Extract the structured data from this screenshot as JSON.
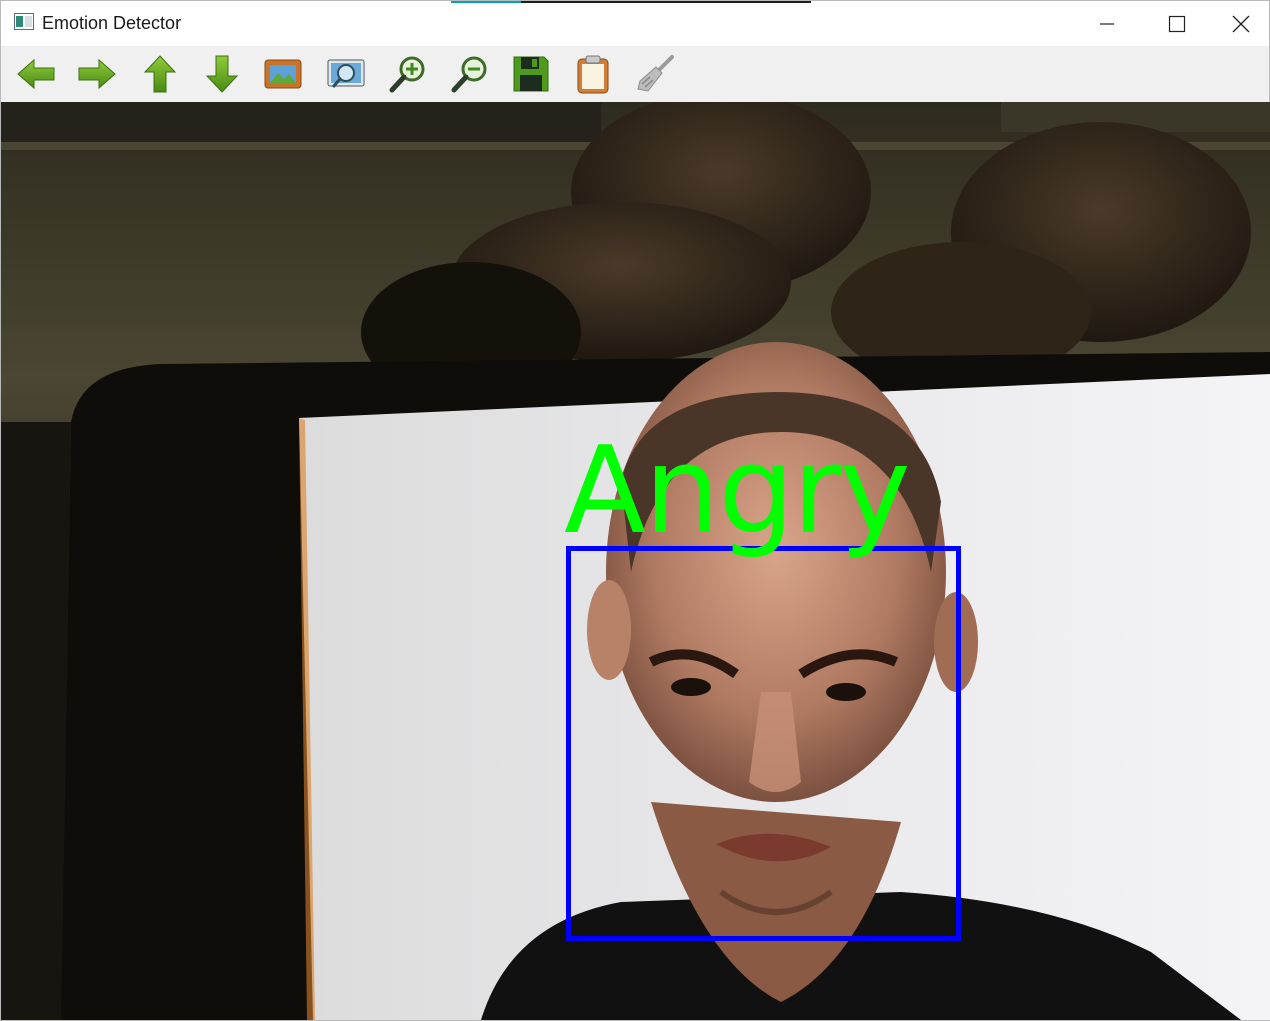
{
  "window": {
    "title": "Emotion Detector",
    "controls": [
      "minimize",
      "maximize",
      "close"
    ]
  },
  "toolbar": {
    "tools": [
      {
        "name": "pan-left",
        "icon": "arrow-left-icon"
      },
      {
        "name": "pan-right",
        "icon": "arrow-right-icon"
      },
      {
        "name": "pan-up",
        "icon": "arrow-up-icon"
      },
      {
        "name": "pan-down",
        "icon": "arrow-down-icon"
      },
      {
        "name": "zoom-to-fit",
        "icon": "image-fit-icon"
      },
      {
        "name": "zoom-to-region",
        "icon": "zoom-region-icon"
      },
      {
        "name": "zoom-in",
        "icon": "zoom-in-icon"
      },
      {
        "name": "zoom-out",
        "icon": "zoom-out-icon"
      },
      {
        "name": "save-image",
        "icon": "floppy-disk-icon"
      },
      {
        "name": "copy-to-clipboard",
        "icon": "clipboard-icon"
      },
      {
        "name": "properties",
        "icon": "brush-icon"
      }
    ]
  },
  "detection": {
    "emotion": "Angry",
    "label_color": "#00ff00",
    "box_color": "#0000ff"
  }
}
